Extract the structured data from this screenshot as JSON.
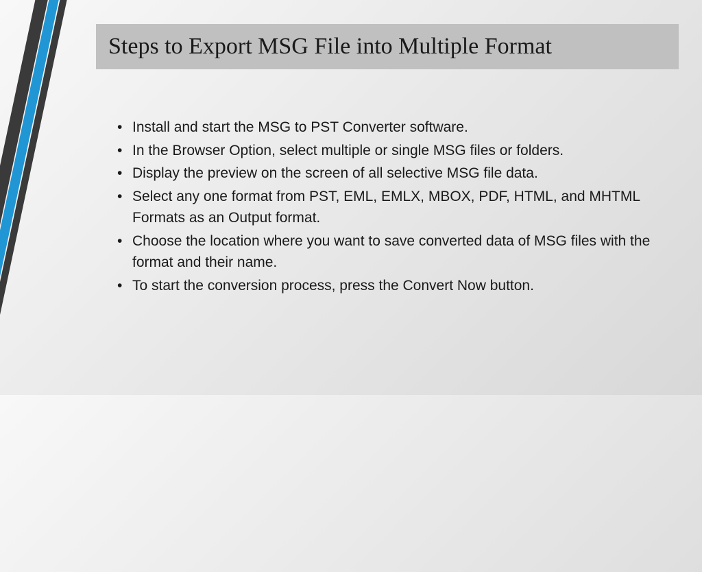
{
  "title": "Steps to Export MSG File into Multiple Format",
  "bullets": [
    "Install and start the MSG to PST Converter software.",
    "In the Browser Option, select multiple or single MSG files or folders.",
    "Display the preview on the screen of all selective MSG file data.",
    "Select any one format from PST, EML, EMLX, MBOX, PDF, HTML, and MHTML Formats as an Output format.",
    "Choose the location where you want to save converted data of MSG files with the format and their name.",
    "To start the conversion process, press the Convert Now button."
  ]
}
